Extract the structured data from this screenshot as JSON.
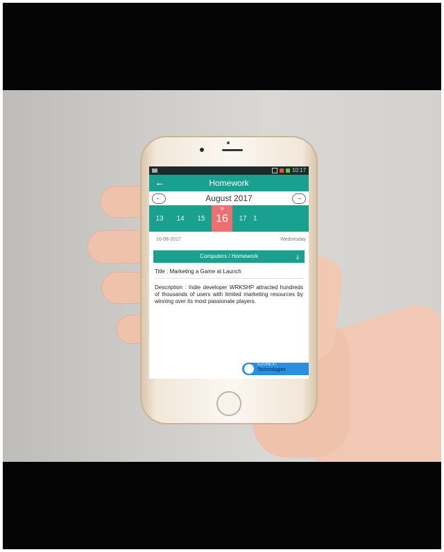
{
  "status_bar": {
    "time": "10:17"
  },
  "app_bar": {
    "back_icon": "arrow-left-icon",
    "title": "Homework"
  },
  "calendar": {
    "month": "August 2017",
    "prev_icon": "arrow-left-circle-icon",
    "next_icon": "arrow-right-circle-icon",
    "days": [
      "13",
      "14",
      "15",
      "16",
      "17",
      "1"
    ],
    "selected_day": "16",
    "selected_superscript": "W"
  },
  "entry": {
    "date": "16-08-2017",
    "weekday": "Wednesday",
    "subject": "Computers / Homework",
    "title": "Title : Marketing a Game at Launch",
    "description": "Description : Indie developer WRKSHP attracted hundreds of thousands of users with limited marketing resources by winning over its most passionate players."
  },
  "brand": {
    "line1": "EDUNEXT",
    "line2": "Technologies"
  },
  "colors": {
    "app_teal": "#1aa08e",
    "selected_red": "#ee6f6f",
    "brand_blue": "#2a8fe0"
  }
}
